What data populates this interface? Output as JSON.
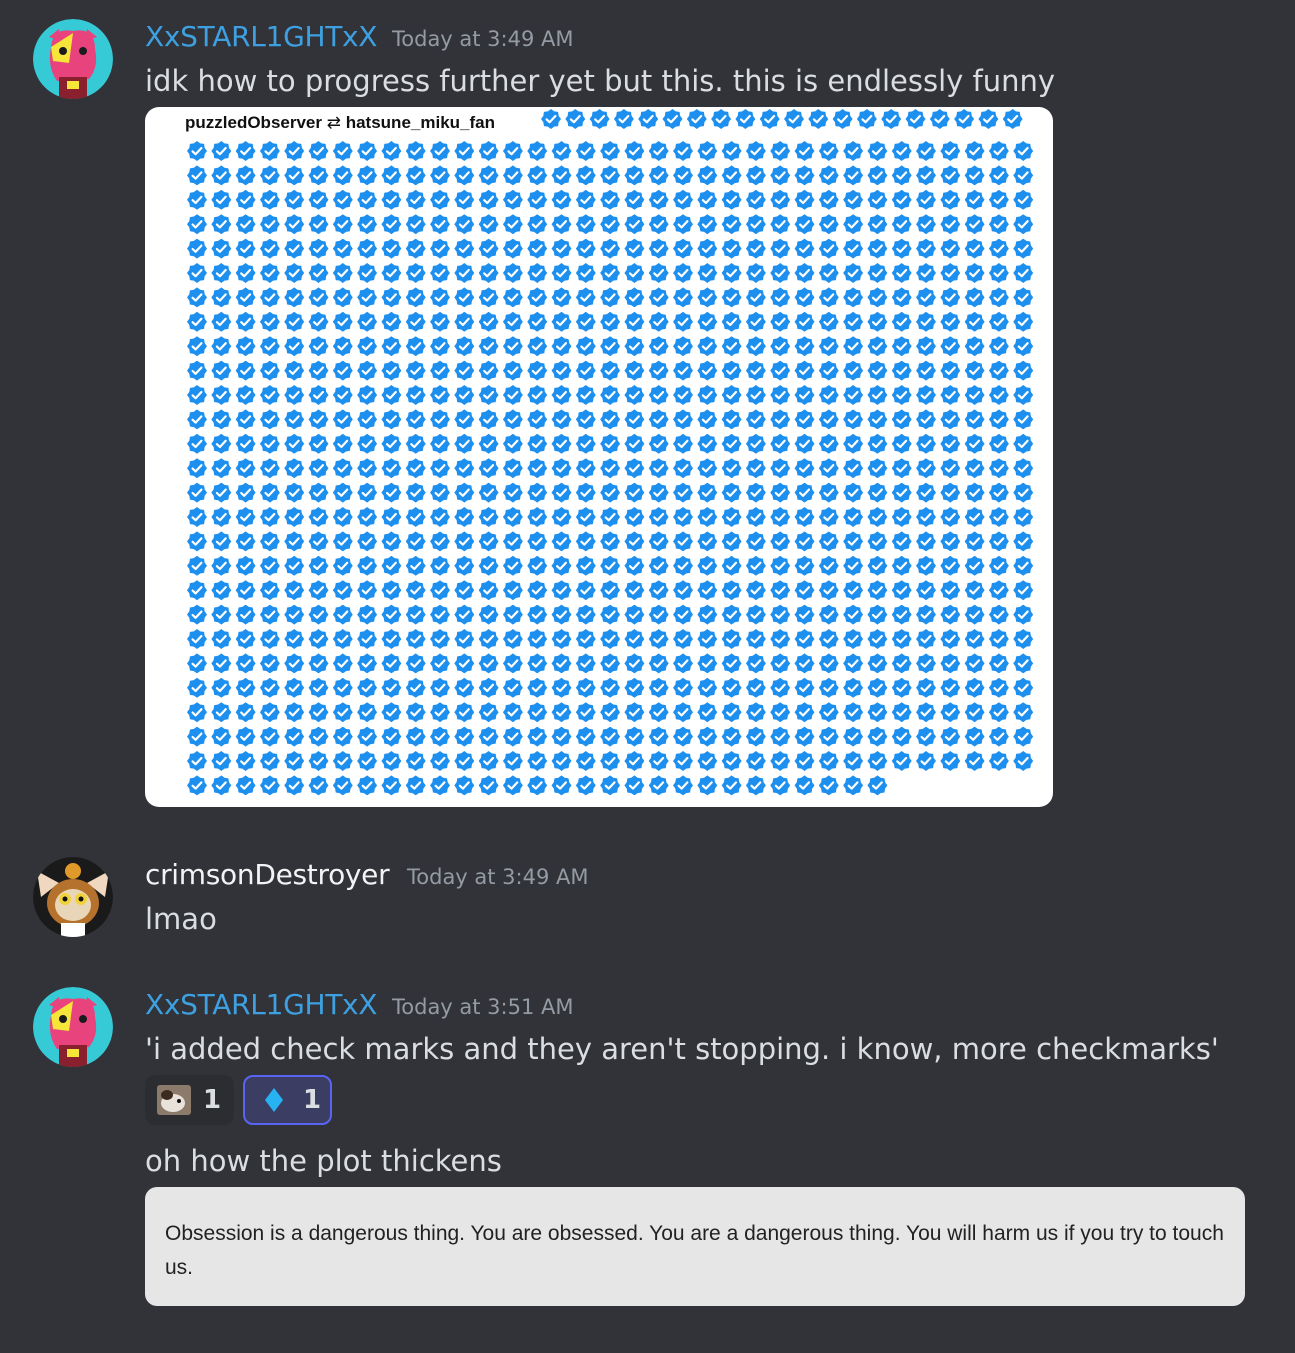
{
  "messages": [
    {
      "username": "XxSTARL1GHTxX",
      "timestamp": "Today at 3:49 AM",
      "text": "idk how to progress further yet but this. this is endlessly funny",
      "attachment": {
        "from_user": "puzzledObserver",
        "arrow": "⇄",
        "to_user": "hatsune_miku_fan",
        "checkmark_color": "#1d8fef"
      }
    },
    {
      "username": "crimsonDestroyer",
      "timestamp": "Today at 3:49 AM",
      "text": "lmao"
    },
    {
      "username": "XxSTARL1GHTxX",
      "timestamp": "Today at 3:51 AM",
      "text": "'i added check marks and they aren't stopping. i know, more checkmarks'",
      "reactions": [
        {
          "emoji": "dog-photo-emoji",
          "count": "1"
        },
        {
          "emoji": "blue-diamond-emoji",
          "count": "1"
        }
      ],
      "followup_text": "oh how the plot thickens",
      "quote": "Obsession is a dangerous thing. You are obsessed. You are a dangerous thing. You will harm us if you try to touch us."
    }
  ],
  "colors": {
    "background": "#313338",
    "star_username": "#3ea0e0",
    "crimson_username": "#f2f3f5",
    "timestamp": "#949ba4",
    "reaction_active_border": "#5865f2"
  }
}
